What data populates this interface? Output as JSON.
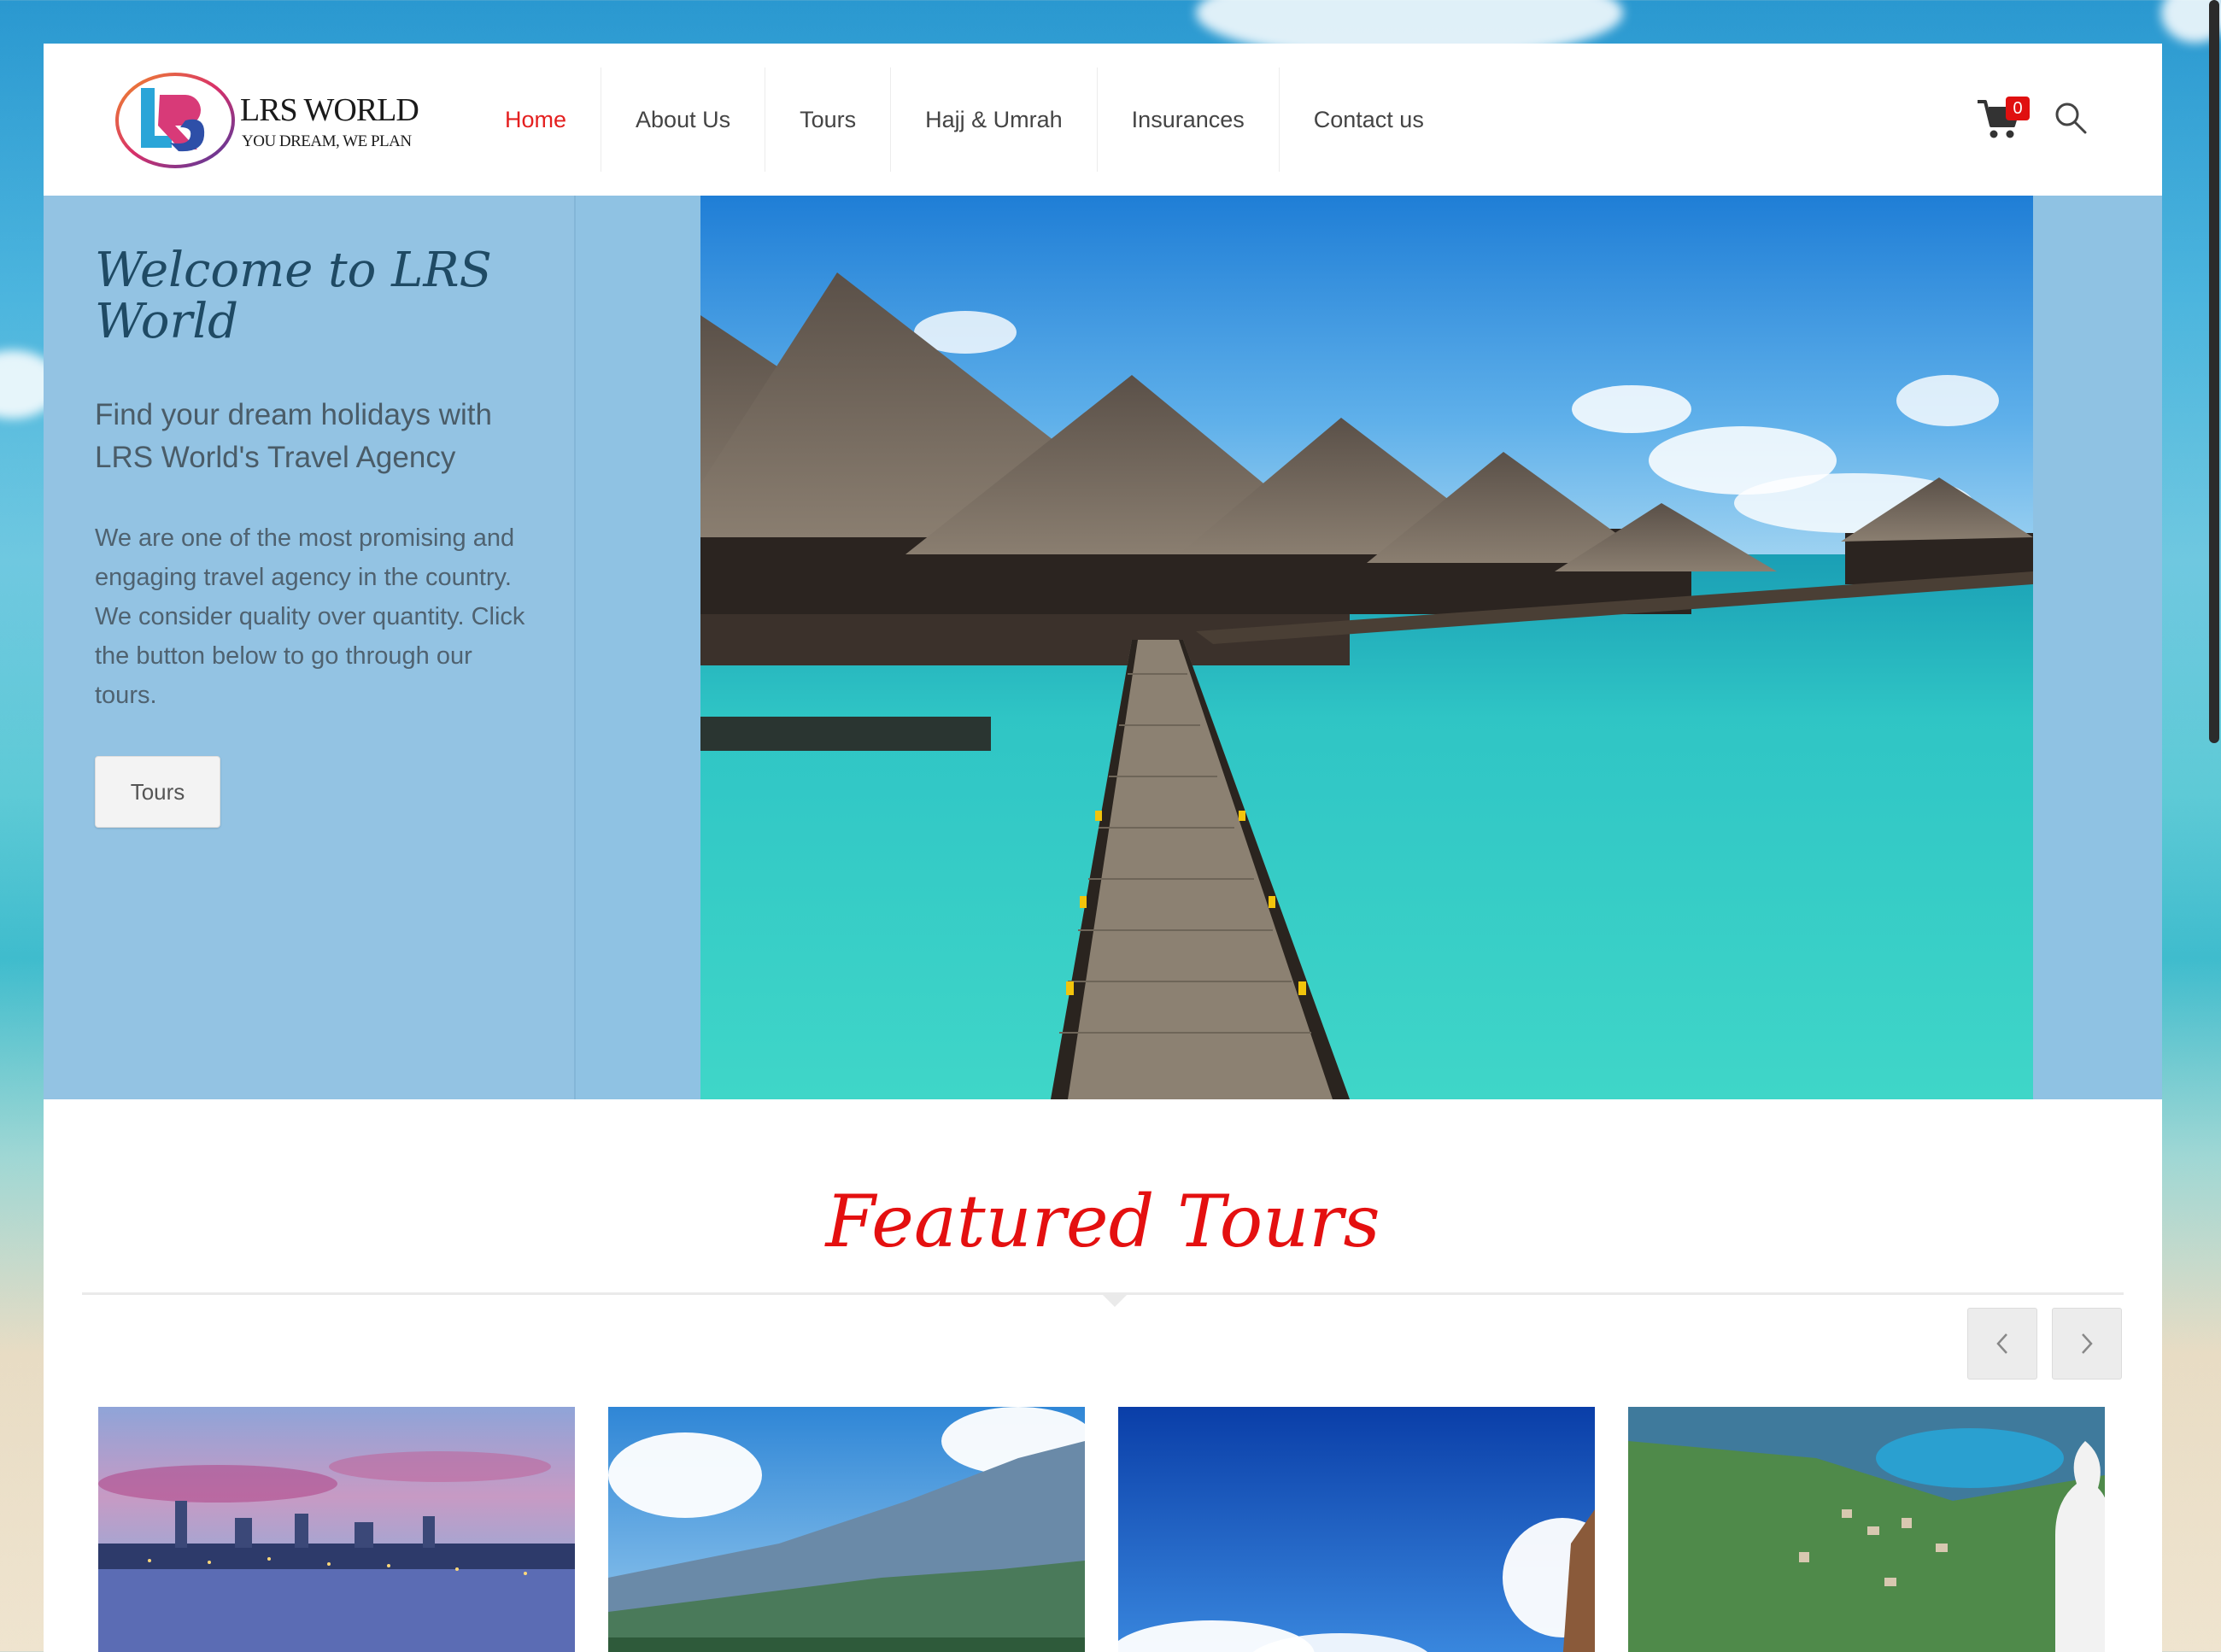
{
  "site": {
    "logo_title": "LRS WORLD",
    "logo_tagline": "YOU DREAM, WE PLAN",
    "logo_icon": "lrs-monogram-logo"
  },
  "nav": {
    "items": [
      {
        "label": "Home",
        "active": true
      },
      {
        "label": "About Us"
      },
      {
        "label": "Tours"
      },
      {
        "label": "Hajj & Umrah"
      },
      {
        "label": "Insurances"
      },
      {
        "label": "Contact us"
      }
    ],
    "cart_count": "0",
    "cart_icon": "shopping-cart-icon",
    "search_icon": "magnifier-icon"
  },
  "hero": {
    "title": "Welcome to LRS World",
    "subtitle": "Find your dream holidays with LRS World's Travel Agency",
    "description": "We are one of the most promising and engaging travel agency in the country. We consider quality over quantity. Click the button below to go through our tours.",
    "button_label": "Tours"
  },
  "featured": {
    "title": "Featured Tours",
    "prev_icon": "chevron-left-icon",
    "next_icon": "chevron-right-icon"
  },
  "colors": {
    "accent_red": "#e41f1f",
    "hero_panel": "#93c3e3",
    "badge_red": "#e01010"
  }
}
